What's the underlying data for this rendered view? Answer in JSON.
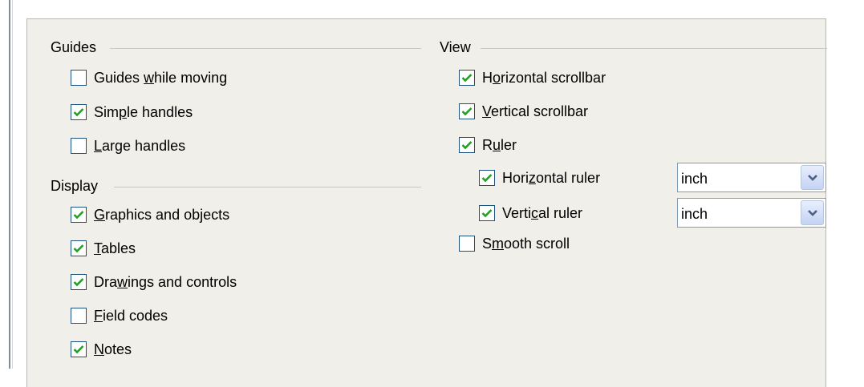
{
  "guides": {
    "title": "Guides",
    "items": [
      {
        "pre": "Guides ",
        "acc": "w",
        "post": "hile moving",
        "checked": false
      },
      {
        "pre": "Sim",
        "acc": "p",
        "post": "le handles",
        "checked": true
      },
      {
        "pre": "",
        "acc": "L",
        "post": "arge handles",
        "checked": false
      }
    ]
  },
  "display": {
    "title": "Display",
    "items": [
      {
        "pre": "",
        "acc": "G",
        "post": "raphics and objects",
        "checked": true
      },
      {
        "pre": "",
        "acc": "T",
        "post": "ables",
        "checked": true
      },
      {
        "pre": "Dra",
        "acc": "w",
        "post": "ings and controls",
        "checked": true
      },
      {
        "pre": "",
        "acc": "F",
        "post": "ield codes",
        "checked": false
      },
      {
        "pre": "",
        "acc": "N",
        "post": "otes",
        "checked": true
      }
    ]
  },
  "view": {
    "title": "View",
    "items": [
      {
        "pre": "H",
        "acc": "o",
        "post": "rizontal scrollbar",
        "checked": true
      },
      {
        "pre": "",
        "acc": "V",
        "post": "ertical scrollbar",
        "checked": true
      },
      {
        "pre": "R",
        "acc": "u",
        "post": "ler",
        "checked": true
      },
      {
        "pre": "Hori",
        "acc": "z",
        "post": "ontal ruler",
        "checked": true,
        "unit": "inch"
      },
      {
        "pre": "Verti",
        "acc": "c",
        "post": "al ruler",
        "checked": true,
        "unit": "inch"
      },
      {
        "pre": "S",
        "acc": "m",
        "post": "ooth scroll",
        "checked": false
      }
    ]
  },
  "colors": {
    "check": "#21a121",
    "panel": "#f0efe9",
    "border": "#1c5180"
  }
}
